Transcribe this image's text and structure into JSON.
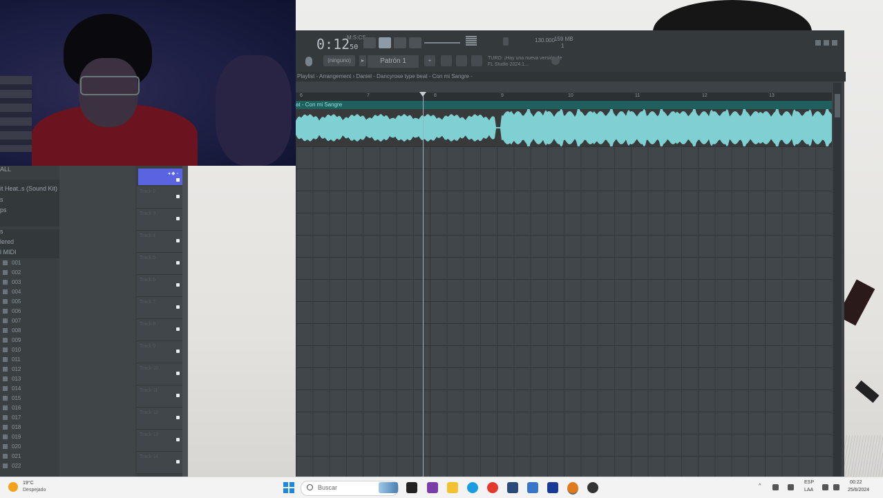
{
  "fl": {
    "time_main": "0:12",
    "time_sub": "50",
    "time_label": "M:S:CS",
    "tempo_value": "130.000",
    "cpu_label": "159 MB",
    "cpu_value": "1",
    "snap_label": "(ninguno)",
    "pattern_label": "Patrón 1",
    "hint_text": "TURO: ¡Hay una nueva versión de FL Studio 2024.1...",
    "playlist_title": "Playlist - Arrangement › Daniel - Dancyrose type beat - Con mi Sangre -",
    "clip_title": "at - Con mi Sangre",
    "ruler_marks": [
      "6",
      "7",
      "8",
      "9",
      "10",
      "11",
      "12",
      "13"
    ]
  },
  "browser": {
    "items": [
      "ALL",
      "it Heat..s (Sound Kit)",
      "s",
      "ps",
      "s",
      "lered",
      "l MIDI"
    ],
    "folders": [
      "001",
      "002",
      "003",
      "004",
      "005",
      "006",
      "007",
      "008",
      "009",
      "010",
      "011",
      "012",
      "013",
      "014",
      "015",
      "016",
      "017",
      "018",
      "019",
      "020",
      "021",
      "022"
    ]
  },
  "tracks": {
    "names": [
      "Track 2",
      "Track 3",
      "Track 4",
      "Track 5",
      "Track 6",
      "Track 7",
      "Track 8",
      "Track 9",
      "Track 10",
      "Track 11",
      "Track 12",
      "Track 13",
      "Track 14"
    ]
  },
  "taskbar": {
    "temperature": "19°C",
    "condition": "Despejado",
    "search_placeholder": "Buscar",
    "lang_top": "ESP",
    "lang_bottom": "LAA",
    "time": "00:22",
    "date": "25/6/2024"
  },
  "colors": {
    "waveform": "#7fd0d2",
    "clip_header": "#1f5f5e",
    "track_selected": "#5a63e0",
    "accent_orange": "#f4a11c"
  }
}
